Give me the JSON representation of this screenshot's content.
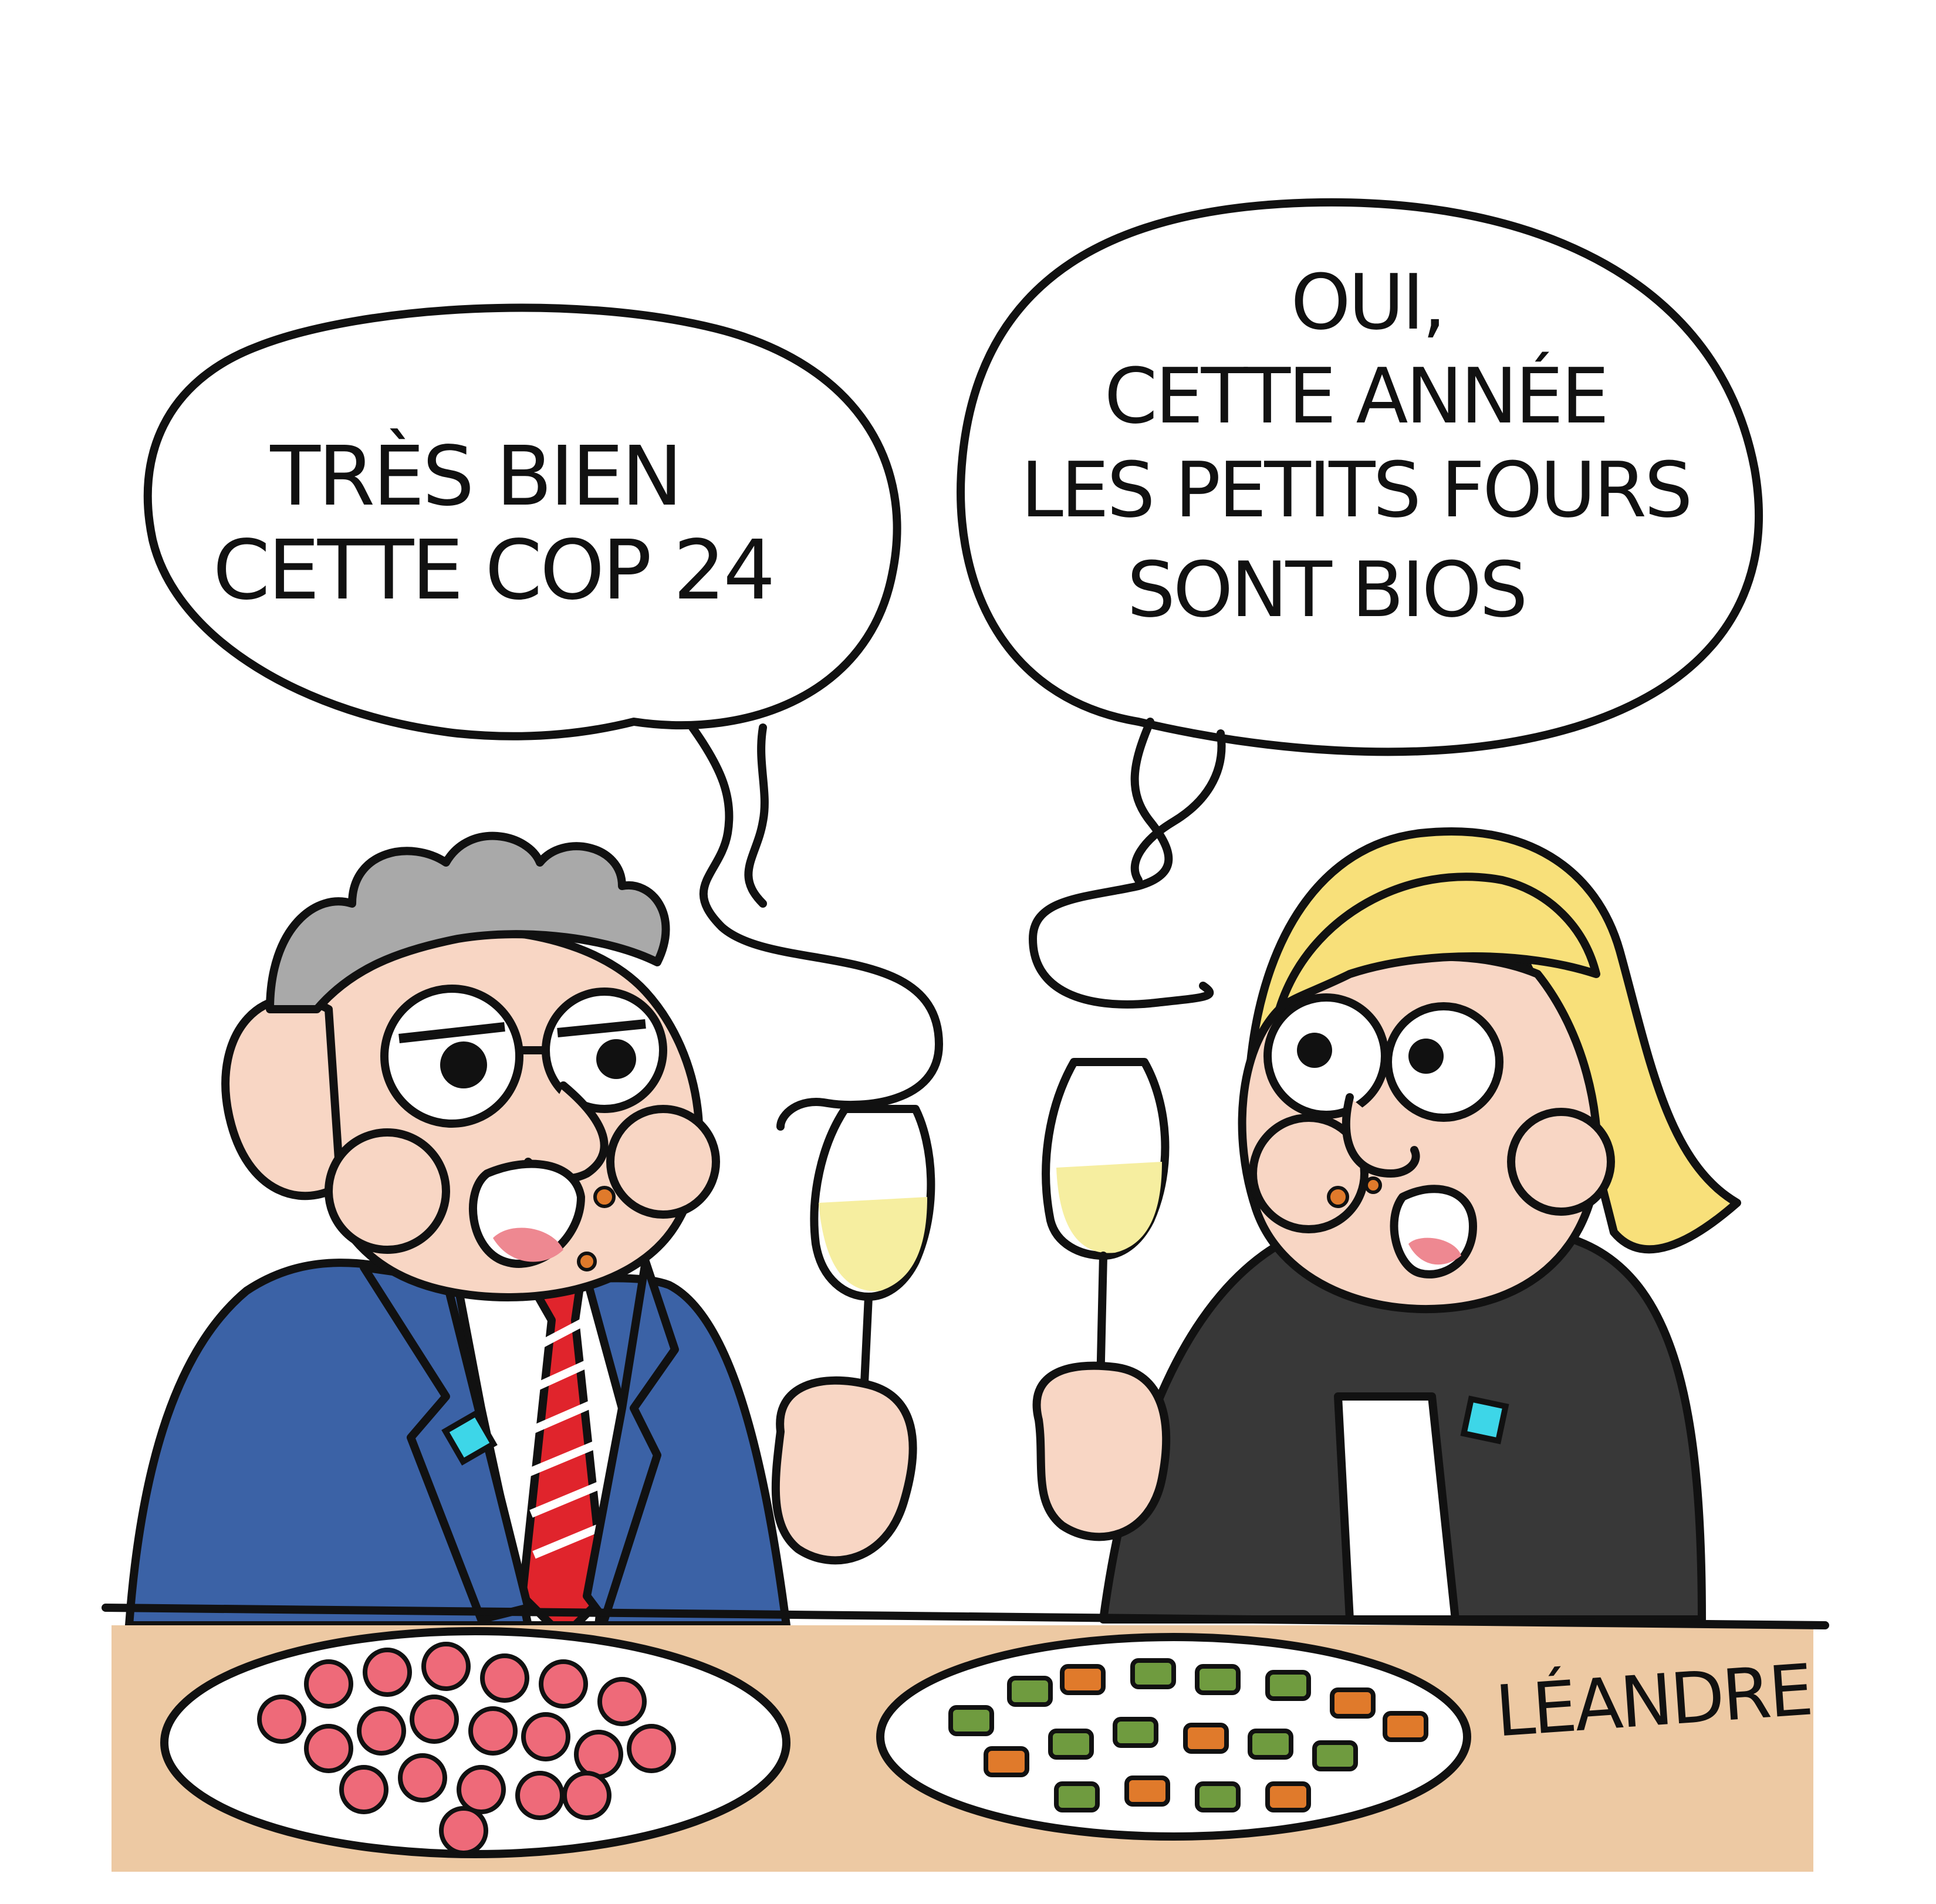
{
  "speech_left": {
    "line1": "TRÈS BIEN",
    "line2": "CETTE COP 24"
  },
  "speech_right": {
    "line1": "OUI,",
    "line2": "CETTE ANNÉE",
    "line3": "LES PETITS FOURS",
    "line4": "SONT BIOS"
  },
  "signature": "LÉANDRE",
  "colors": {
    "background": "#ffffff",
    "ink": "#111111",
    "skin": "#f8d6c4",
    "man_hair": "#a9a9a9",
    "man_jacket": "#3b62a6",
    "tie_red": "#e0242c",
    "woman_hair": "#f8e07a",
    "woman_jacket": "#383838",
    "table": "#edc9a3",
    "champagne": "#f6eea0",
    "badge": "#3dd6e8",
    "strawberry": "#ee6a79",
    "petit_four_green": "#6f9b3f",
    "petit_four_orange": "#e07a2b"
  }
}
